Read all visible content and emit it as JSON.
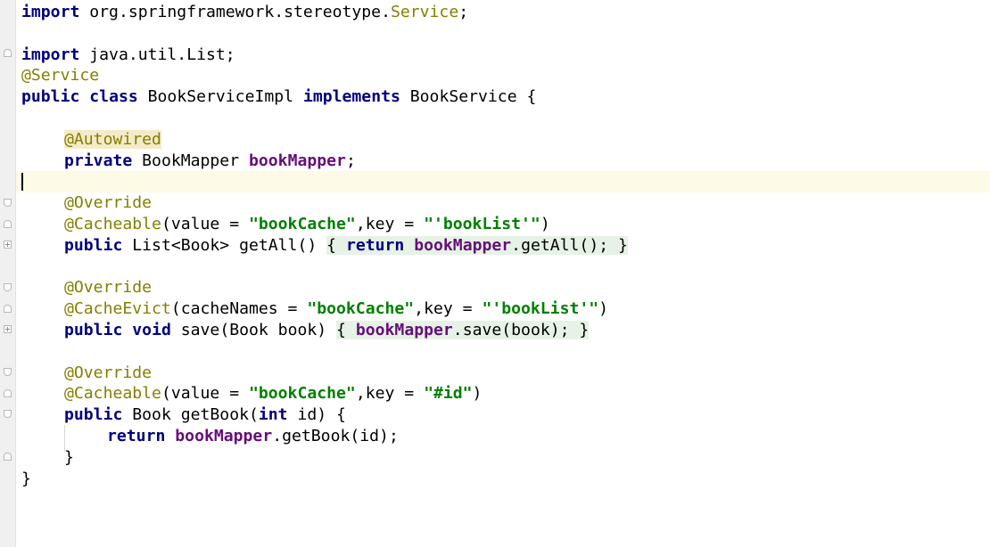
{
  "code": {
    "l1": {
      "kw": "import",
      "pkg": " org.springframework.stereotype.",
      "ann": "Service",
      "end": ";"
    },
    "l3": {
      "kw": "import",
      "rest": " java.util.List;"
    },
    "l4": {
      "ann": "@Service"
    },
    "l5": {
      "kw1": "public",
      "kw2": "class",
      "name": " BookServiceImpl ",
      "kw3": "implements",
      "rest": " BookService {"
    },
    "l7": {
      "ann": "@Autowired"
    },
    "l8": {
      "kw": "private",
      "type": " BookMapper ",
      "field": "bookMapper",
      "end": ";"
    },
    "l10": {
      "ann": "@Override"
    },
    "l11": {
      "ann": "@Cacheable",
      "p1": "(value = ",
      "s1": "\"bookCache\"",
      "p2": ",key = ",
      "s2": "\"'bookList'\"",
      "end": ")"
    },
    "l12": {
      "kw": "public",
      "sig": " List<Book> getAll() ",
      "ob": "{",
      "kw2": "return",
      "field": "bookMapper",
      "call": ".getAll(); ",
      "cb": "}"
    },
    "l14": {
      "ann": "@Override"
    },
    "l15": {
      "ann": "@CacheEvict",
      "p1": "(cacheNames = ",
      "s1": "\"bookCache\"",
      "p2": ",key = ",
      "s2": "\"'bookList'\"",
      "end": ")"
    },
    "l16": {
      "kw": "public",
      "kw2": "void",
      "sig": " save(Book book) ",
      "ob": "{",
      "field": "bookMapper",
      "call": ".save(book); ",
      "cb": "}"
    },
    "l18": {
      "ann": "@Override"
    },
    "l19": {
      "ann": "@Cacheable",
      "p1": "(value = ",
      "s1": "\"bookCache\"",
      "p2": ",key = ",
      "s2": "\"#id\"",
      "end": ")"
    },
    "l20": {
      "kw": "public",
      "sig1": " Book getBook(",
      "kw2": "int",
      "sig2": " id) {"
    },
    "l21": {
      "kw": "return",
      "field": "bookMapper",
      "call": ".getBook(id);"
    },
    "l22": {
      "text": "}"
    },
    "l23": {
      "text": "}"
    }
  }
}
